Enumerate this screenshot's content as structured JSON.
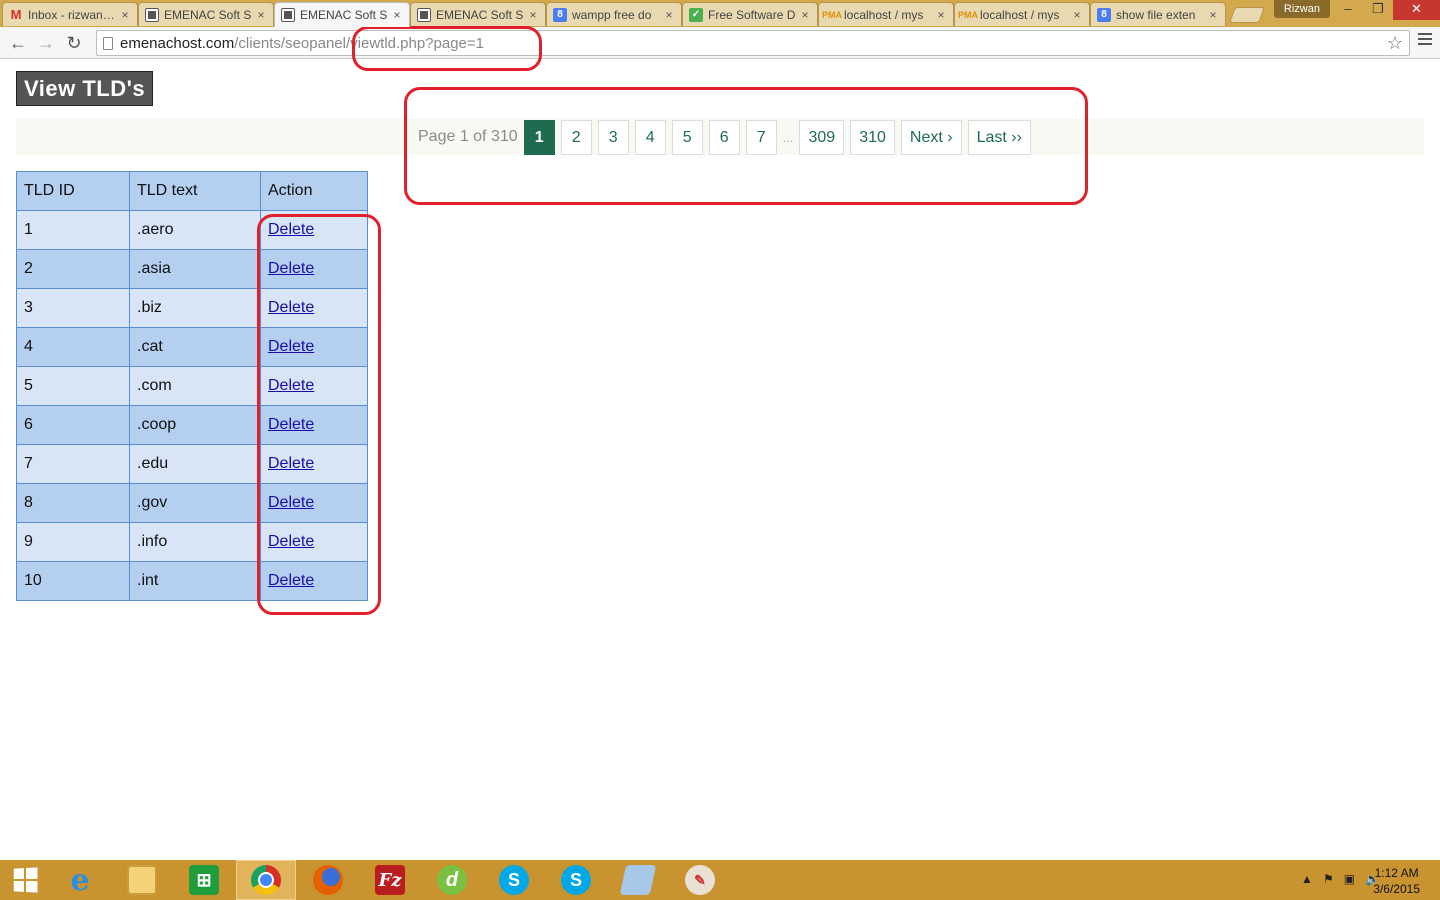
{
  "browser": {
    "tabs": [
      {
        "title": "Inbox - rizwan…",
        "icon": "gmail-icon",
        "active": false
      },
      {
        "title": "EMENAC Soft S",
        "icon": "page-grid-icon",
        "active": false
      },
      {
        "title": "EMENAC Soft S",
        "icon": "page-grid-icon",
        "active": true
      },
      {
        "title": "EMENAC Soft S",
        "icon": "page-grid-icon",
        "active": false
      },
      {
        "title": "wampp free do",
        "icon": "google-icon",
        "active": false
      },
      {
        "title": "Free Software D",
        "icon": "check-icon",
        "active": false
      },
      {
        "title": "localhost / mys",
        "icon": "phpmyadmin-icon",
        "active": false
      },
      {
        "title": "localhost / mys",
        "icon": "phpmyadmin-icon",
        "active": false
      },
      {
        "title": "show file exten",
        "icon": "google-icon",
        "active": false
      }
    ],
    "tab_close_glyph": "×",
    "user_name": "Rizwan",
    "window_controls": {
      "minimize": "–",
      "maximize": "❐",
      "close": "✕"
    },
    "nav": {
      "back": "←",
      "forward": "→",
      "reload": "↻"
    },
    "url_host": "emenachost.com",
    "url_path": "/clients/seopanel/viewtld.php?page=1",
    "bookmark_star": "☆"
  },
  "page": {
    "title": "View TLD's",
    "pagination": {
      "info": "Page 1 of 310",
      "pages": [
        "1",
        "2",
        "3",
        "4",
        "5",
        "6",
        "7"
      ],
      "current": "1",
      "ellipsis": "...",
      "tail_pages": [
        "309",
        "310"
      ],
      "next": "Next ›",
      "last": "Last ››"
    },
    "table": {
      "headers": [
        "TLD ID",
        "TLD text",
        "Action"
      ],
      "rows": [
        {
          "id": "1",
          "text": ".aero",
          "action": "Delete"
        },
        {
          "id": "2",
          "text": ".asia",
          "action": "Delete"
        },
        {
          "id": "3",
          "text": ".biz",
          "action": "Delete"
        },
        {
          "id": "4",
          "text": ".cat",
          "action": "Delete"
        },
        {
          "id": "5",
          "text": ".com",
          "action": "Delete"
        },
        {
          "id": "6",
          "text": ".coop",
          "action": "Delete"
        },
        {
          "id": "7",
          "text": ".edu",
          "action": "Delete"
        },
        {
          "id": "8",
          "text": ".gov",
          "action": "Delete"
        },
        {
          "id": "9",
          "text": ".info",
          "action": "Delete"
        },
        {
          "id": "10",
          "text": ".int",
          "action": "Delete"
        }
      ]
    }
  },
  "taskbar": {
    "apps": [
      {
        "name": "internet-explorer-icon",
        "glyph": "e",
        "cls": "ie",
        "active": false
      },
      {
        "name": "file-explorer-icon",
        "glyph": "",
        "cls": "folder",
        "active": false
      },
      {
        "name": "windows-store-icon",
        "glyph": "⊞",
        "cls": "store",
        "active": false
      },
      {
        "name": "chrome-icon",
        "glyph": "",
        "cls": "chrome",
        "active": true
      },
      {
        "name": "firefox-icon",
        "glyph": "",
        "cls": "ff",
        "active": false
      },
      {
        "name": "filezilla-icon",
        "glyph": "Fz",
        "cls": "fz",
        "active": false
      },
      {
        "name": "dreamweaver-icon",
        "glyph": "d",
        "cls": "dw",
        "active": false
      },
      {
        "name": "skype-icon",
        "glyph": "S",
        "cls": "sky",
        "active": false
      },
      {
        "name": "skype-icon",
        "glyph": "S",
        "cls": "sky",
        "active": false
      },
      {
        "name": "notepad-icon",
        "glyph": "",
        "cls": "note",
        "active": false
      },
      {
        "name": "paint-icon",
        "glyph": "✎",
        "cls": "paint",
        "active": false
      }
    ],
    "tray_icons": [
      "▲",
      "⚑",
      "▣",
      "🔈"
    ],
    "time": "1:12 AM",
    "date": "3/6/2015"
  },
  "colors": {
    "accent": "#1f6b50",
    "table_header": "#b4cff0",
    "table_row_light": "#d7e5f7",
    "annotation": "#e0202a",
    "taskbar": "#c9932f"
  }
}
